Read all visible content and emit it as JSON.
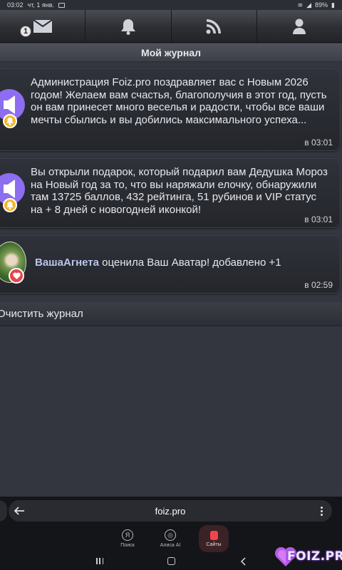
{
  "status_bar": {
    "time": "03:02",
    "date": "чт, 1 янв.",
    "battery": "89%"
  },
  "top_nav": {
    "messages_badge": "1"
  },
  "page_title": "Мой журнал",
  "entries": [
    {
      "text": "Администрация Foiz.pro поздравляет вас с Новым 2026 годом! Желаем вам счастья, благополучия в этот год, пусть он вам принесет много веселья и радости, чтобы все ваши мечты сбылись и вы добились максимального успеха...",
      "time": "в 03:01",
      "avatar": "admin-megaphone-icon",
      "badge": "bell-icon"
    },
    {
      "text": "Вы открыли подарок, который подарил вам Дедушка Мороз на Новый год за то, что вы наряжали елочку, обнаружили там 13725 баллов, 432 рейтинга, 51 рубинов и VIP статус на + 8 дней с новогодней иконкой!",
      "time": "в 03:01",
      "avatar": "admin-megaphone-icon",
      "badge": "bell-icon"
    },
    {
      "user": "ВашаАгнета",
      "text": " оценила Ваш Аватар! добавлено +1",
      "time": "в 02:59",
      "avatar": "user-photo",
      "badge": "heart-icon"
    }
  ],
  "clear_button": "Очистить журнал",
  "browser": {
    "url": "foiz.pro",
    "tabs": [
      {
        "icon_text": "Я",
        "label": "Поиск"
      },
      {
        "icon_text": "◎",
        "label": "Алиса AI"
      },
      {
        "icon_text": "",
        "label": "Сайты"
      }
    ]
  },
  "watermark": "FOIZ.PRO",
  "colors": {
    "accent_bell": "#f5b623",
    "heart": "#e8444d",
    "admin_avatar": "#8d6df0",
    "bg": "#33363f"
  }
}
